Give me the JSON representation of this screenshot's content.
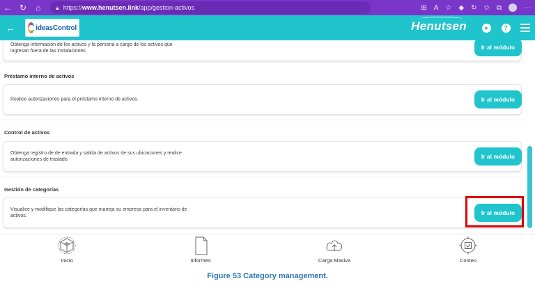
{
  "browser": {
    "url_prefix": "https://",
    "url_domain": "www.henutsen.link",
    "url_path": "/app/gestion-activos"
  },
  "header": {
    "logo_text": "ideasControl",
    "brand": "Henutsen"
  },
  "sections": [
    {
      "title": "",
      "description": "Obtenga información de los activos y la persona a cargo de los activos que ingresan fuera de las instalaciones.",
      "button": "Ir al módulo"
    },
    {
      "title": "Préstamo interno de activos",
      "description": "Realice autorizaciones para el préstamo interno  de activos.",
      "button": "Ir al módulo"
    },
    {
      "title": "Control de activos",
      "description": "Obtenga registro de de entrada y salida de activos de sus ubicaciones y realice autorizaciones de traslado.",
      "button": "Ir al módulo"
    },
    {
      "title": "Gestión de categorías",
      "description": "Visualice y modifique las categorías que maneja su empresa para el inventario de activos.",
      "button": "Ir al módulo"
    }
  ],
  "bottom_nav": [
    {
      "label": "Inicio",
      "icon": "home-cube-icon"
    },
    {
      "label": "Informes",
      "icon": "document-icon"
    },
    {
      "label": "Carga Masiva",
      "icon": "cloud-upload-icon"
    },
    {
      "label": "Conteo",
      "icon": "target-check-icon"
    }
  ],
  "caption": "Figure 53 Category management.",
  "colors": {
    "browser": "#7a35c9",
    "accent": "#20c4cd",
    "highlight": "#e00000",
    "caption": "#2e75b6"
  }
}
